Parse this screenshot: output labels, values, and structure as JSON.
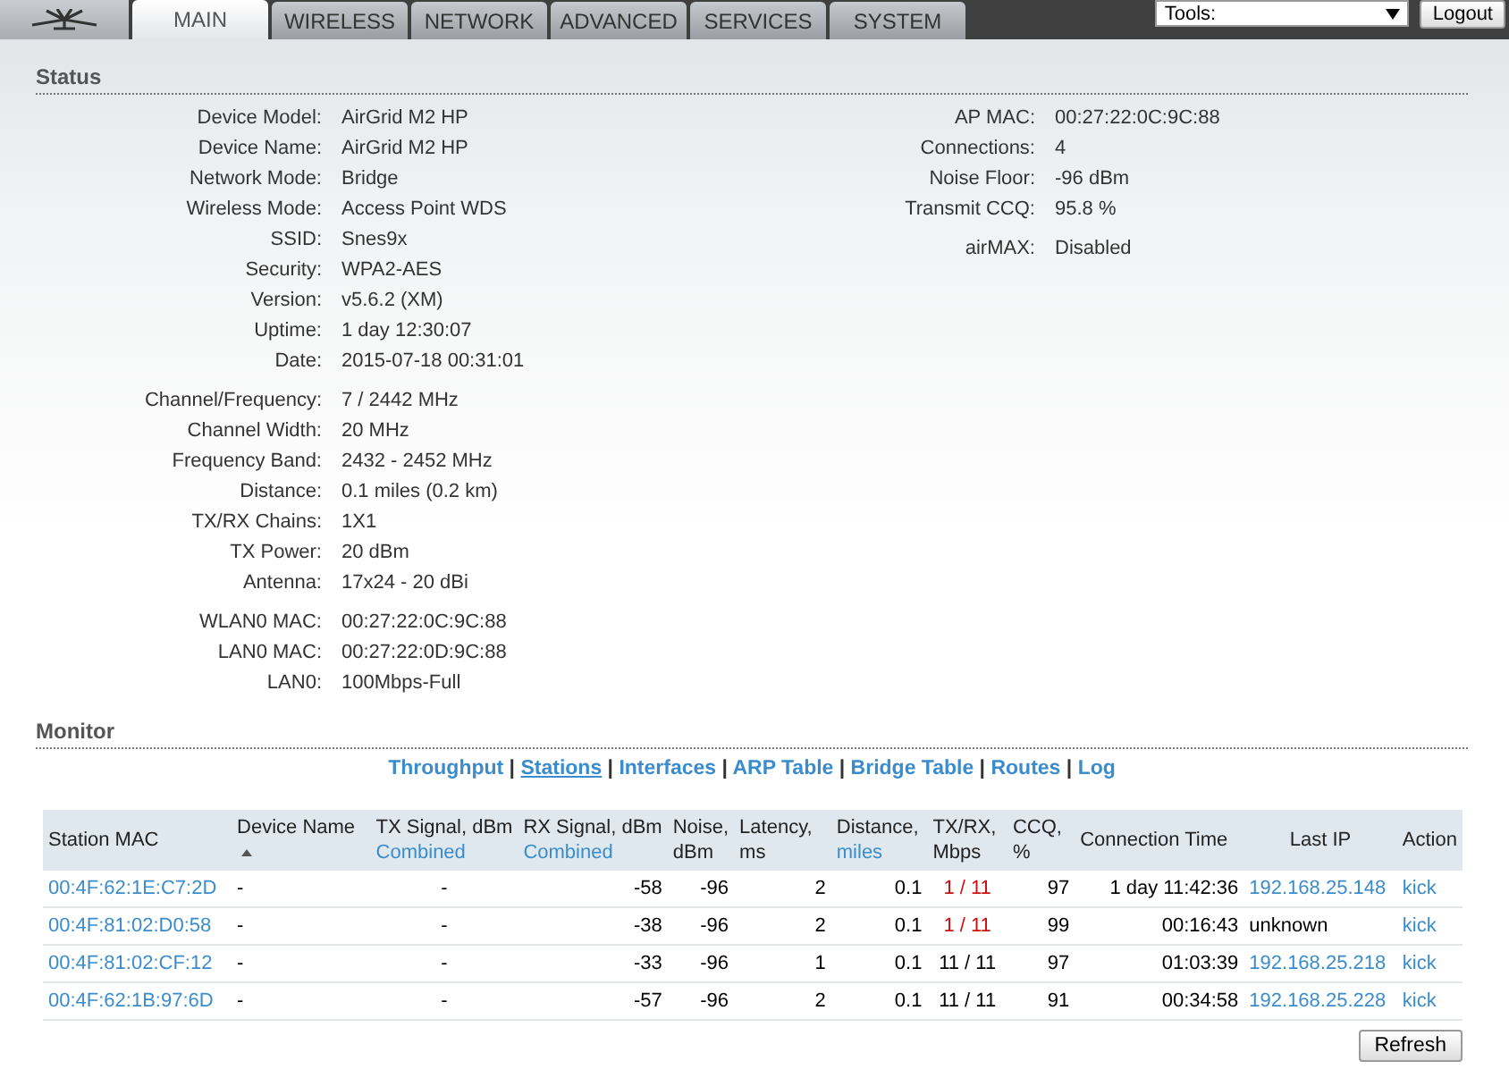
{
  "nav": {
    "tabs": [
      {
        "label": "MAIN",
        "selected": true
      },
      {
        "label": "WIRELESS",
        "selected": false
      },
      {
        "label": "NETWORK",
        "selected": false
      },
      {
        "label": "ADVANCED",
        "selected": false
      },
      {
        "label": "SERVICES",
        "selected": false
      },
      {
        "label": "SYSTEM",
        "selected": false
      }
    ],
    "tools": {
      "value": "Tools:"
    },
    "logout": "Logout"
  },
  "status": {
    "title": "Status",
    "left_groups": [
      [
        {
          "label": "Device Model:",
          "value": "AirGrid M2 HP"
        },
        {
          "label": "Device Name:",
          "value": "AirGrid M2 HP"
        },
        {
          "label": "Network Mode:",
          "value": "Bridge"
        },
        {
          "label": "Wireless Mode:",
          "value": "Access Point WDS"
        },
        {
          "label": "SSID:",
          "value": "Snes9x"
        },
        {
          "label": "Security:",
          "value": "WPA2-AES"
        },
        {
          "label": "Version:",
          "value": "v5.6.2 (XM)"
        },
        {
          "label": "Uptime:",
          "value": "1 day 12:30:07"
        },
        {
          "label": "Date:",
          "value": "2015-07-18 00:31:01"
        }
      ],
      [
        {
          "label": "Channel/Frequency:",
          "value": "7 / 2442 MHz"
        },
        {
          "label": "Channel Width:",
          "value": "20 MHz"
        },
        {
          "label": "Frequency Band:",
          "value": "2432 - 2452 MHz"
        },
        {
          "label": "Distance:",
          "value": "0.1 miles (0.2 km)"
        },
        {
          "label": "TX/RX Chains:",
          "value": "1X1"
        },
        {
          "label": "TX Power:",
          "value": "20 dBm"
        },
        {
          "label": "Antenna:",
          "value": "17x24 - 20 dBi"
        }
      ],
      [
        {
          "label": "WLAN0 MAC:",
          "value": "00:27:22:0C:9C:88"
        },
        {
          "label": "LAN0 MAC:",
          "value": "00:27:22:0D:9C:88"
        },
        {
          "label": "LAN0:",
          "value": "100Mbps-Full"
        }
      ]
    ],
    "right_groups": [
      [
        {
          "label": "AP MAC:",
          "value": "00:27:22:0C:9C:88"
        },
        {
          "label": "Connections:",
          "value": "4"
        },
        {
          "label": "Noise Floor:",
          "value": "-96 dBm"
        },
        {
          "label": "Transmit CCQ:",
          "value": "95.8 %"
        }
      ],
      [
        {
          "label": "airMAX:",
          "value": "Disabled"
        }
      ]
    ]
  },
  "monitor": {
    "title": "Monitor",
    "links": [
      {
        "label": "Throughput",
        "selected": false
      },
      {
        "label": "Stations",
        "selected": true
      },
      {
        "label": "Interfaces",
        "selected": false
      },
      {
        "label": "ARP Table",
        "selected": false
      },
      {
        "label": "Bridge Table",
        "selected": false
      },
      {
        "label": "Routes",
        "selected": false
      },
      {
        "label": "Log",
        "selected": false
      }
    ],
    "separator": "|",
    "columns": [
      {
        "label": "Station MAC",
        "sorted": false
      },
      {
        "label": "Device Name",
        "sorted": true
      },
      {
        "label": "TX Signal, dBm",
        "sublabel": "Combined",
        "sorted": false
      },
      {
        "label": "RX Signal, dBm",
        "sublabel": "Combined",
        "sorted": false
      },
      {
        "label": "Noise, dBm",
        "sorted": false
      },
      {
        "label": "Latency, ms",
        "sorted": false
      },
      {
        "label": "Distance,",
        "sublabel": "miles",
        "sorted": false
      },
      {
        "label": "TX/RX, Mbps",
        "sorted": false
      },
      {
        "label": "CCQ, %",
        "sorted": false
      },
      {
        "label": "Connection Time",
        "sorted": false
      },
      {
        "label": "Last IP",
        "sorted": false
      },
      {
        "label": "Action",
        "sorted": false
      }
    ],
    "rows": [
      {
        "station_mac": "00:4F:62:1E:C7:2D",
        "device_name": "-",
        "tx_signal": "-",
        "rx_signal": "-58",
        "noise": "-96",
        "latency": "2",
        "distance": "0.1",
        "tx_rx": "1 / 11",
        "tx_rx_warning": true,
        "ccq": "97",
        "connection_time": "1 day 11:42:36",
        "last_ip": {
          "text": "192.168.25.148",
          "link": true
        },
        "action": "kick"
      },
      {
        "station_mac": "00:4F:81:02:D0:58",
        "device_name": "-",
        "tx_signal": "-",
        "rx_signal": "-38",
        "noise": "-96",
        "latency": "2",
        "distance": "0.1",
        "tx_rx": "1 / 11",
        "tx_rx_warning": true,
        "ccq": "99",
        "connection_time": "00:16:43",
        "last_ip": {
          "text": "unknown",
          "link": false
        },
        "action": "kick"
      },
      {
        "station_mac": "00:4F:81:02:CF:12",
        "device_name": "-",
        "tx_signal": "-",
        "rx_signal": "-33",
        "noise": "-96",
        "latency": "1",
        "distance": "0.1",
        "tx_rx": "11 / 11",
        "tx_rx_warning": false,
        "ccq": "97",
        "connection_time": "01:03:39",
        "last_ip": {
          "text": "192.168.25.218",
          "link": true
        },
        "action": "kick"
      },
      {
        "station_mac": "00:4F:62:1B:97:6D",
        "device_name": "-",
        "tx_signal": "-",
        "rx_signal": "-57",
        "noise": "-96",
        "latency": "2",
        "distance": "0.1",
        "tx_rx": "11 / 11",
        "tx_rx_warning": false,
        "ccq": "91",
        "connection_time": "00:34:58",
        "last_ip": {
          "text": "192.168.25.228",
          "link": true
        },
        "action": "kick"
      }
    ],
    "refresh": "Refresh"
  }
}
